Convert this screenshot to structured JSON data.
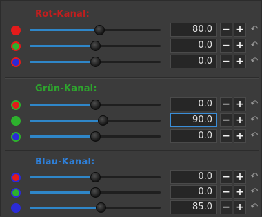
{
  "sections": [
    {
      "title": "Rot-Kanal:",
      "title_color": "#c21e1e",
      "rows": [
        {
          "value": "80.0",
          "fraction": 0.53,
          "dot_fill": "#e41b1b",
          "dot_ring": "#e41b1b"
        },
        {
          "value": "0.0",
          "fraction": 0.5,
          "dot_fill": "#2db12d",
          "dot_ring": "#e41b1b"
        },
        {
          "value": "0.0",
          "fraction": 0.5,
          "dot_fill": "#2b2bd8",
          "dot_ring": "#e41b1b"
        }
      ]
    },
    {
      "title": "Grün-Kanal:",
      "title_color": "#2ea42e",
      "rows": [
        {
          "value": "0.0",
          "fraction": 0.5,
          "dot_fill": "#e41b1b",
          "dot_ring": "#2db12d"
        },
        {
          "value": "90.0",
          "fraction": 0.56,
          "dot_fill": "#2db12d",
          "dot_ring": "#2db12d",
          "active": true
        },
        {
          "value": "0.0",
          "fraction": 0.5,
          "dot_fill": "#2b2bd8",
          "dot_ring": "#2db12d"
        }
      ]
    },
    {
      "title": "Blau-Kanal:",
      "title_color": "#2e7fd8",
      "rows": [
        {
          "value": "0.0",
          "fraction": 0.5,
          "dot_fill": "#e41b1b",
          "dot_ring": "#2b2bd8"
        },
        {
          "value": "0.0",
          "fraction": 0.5,
          "dot_fill": "#2db12d",
          "dot_ring": "#2b2bd8"
        },
        {
          "value": "85.0",
          "fraction": 0.54,
          "dot_fill": "#2b2bd8",
          "dot_ring": "#2b2bd8"
        }
      ]
    }
  ],
  "buttons": {
    "minus": "−",
    "plus": "+",
    "reset": "↶"
  },
  "accent_color": "#2f86c8"
}
